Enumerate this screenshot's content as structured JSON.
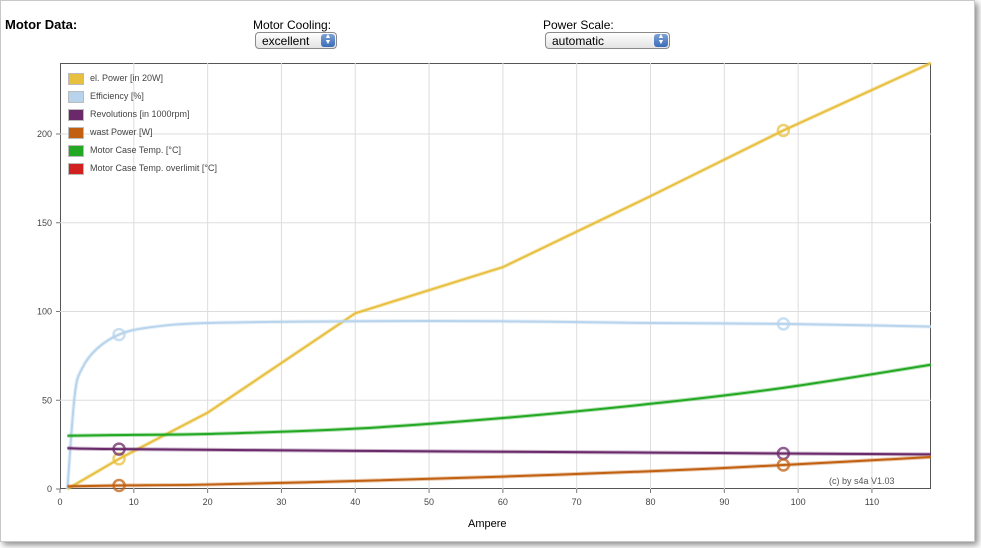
{
  "header": {
    "title": "Motor Data:",
    "cooling_label": "Motor Cooling:",
    "cooling_value": "excellent",
    "power_scale_label": "Power Scale:",
    "power_scale_value": "automatic"
  },
  "credit": "(c) by s4a   V1.03",
  "colors": {
    "power": "#e8c040",
    "efficiency": "#b8d4ec",
    "revolutions": "#6a2a6a",
    "waste": "#c06010",
    "case_temp": "#22a822",
    "overlimit": "#d02020"
  },
  "chart_data": {
    "type": "line",
    "xlabel": "Ampere",
    "ylabel": "",
    "xlim": [
      0,
      118
    ],
    "ylim": [
      0,
      240
    ],
    "xticks": [
      0,
      10,
      20,
      30,
      40,
      50,
      60,
      70,
      80,
      90,
      100,
      110
    ],
    "yticks": [
      0,
      50,
      100,
      150,
      200
    ],
    "grid": true,
    "legend_position": "top-left",
    "legend": [
      {
        "key": "power",
        "label": "el. Power [in 20W]"
      },
      {
        "key": "efficiency",
        "label": "Efficiency [%]"
      },
      {
        "key": "revolutions",
        "label": "Revolutions [in 1000rpm]"
      },
      {
        "key": "waste",
        "label": "wast Power [W]"
      },
      {
        "key": "case_temp",
        "label": "Motor Case Temp. [°C]"
      },
      {
        "key": "overlimit",
        "label": "Motor Case Temp. overlimit [°C]"
      }
    ],
    "series": [
      {
        "key": "power",
        "x": [
          1,
          8,
          20,
          40,
          60,
          80,
          98,
          118
        ],
        "y": [
          0,
          17,
          43,
          99,
          125,
          165,
          202,
          240
        ]
      },
      {
        "key": "efficiency",
        "x": [
          1,
          2,
          3,
          5,
          8,
          12,
          20,
          40,
          60,
          80,
          98,
          118
        ],
        "y": [
          0,
          53,
          68,
          79,
          87,
          91,
          93.5,
          94.5,
          94.5,
          93.5,
          93,
          91.5
        ]
      },
      {
        "key": "revolutions",
        "x": [
          1,
          8,
          40,
          60,
          80,
          98,
          118
        ],
        "y": [
          23,
          22.5,
          21.5,
          21,
          20.5,
          20,
          19.5
        ]
      },
      {
        "key": "waste",
        "x": [
          1,
          8,
          20,
          40,
          60,
          80,
          98,
          118
        ],
        "y": [
          1.5,
          2,
          2.5,
          4.5,
          7,
          10,
          13.5,
          18
        ]
      },
      {
        "key": "case_temp",
        "x": [
          1,
          10,
          20,
          40,
          60,
          80,
          98,
          118
        ],
        "y": [
          30,
          30.5,
          31,
          34,
          40,
          48,
          57,
          70
        ]
      }
    ],
    "markers": [
      {
        "key": "power",
        "x": 8,
        "y": 17
      },
      {
        "key": "power",
        "x": 98,
        "y": 202
      },
      {
        "key": "efficiency",
        "x": 8,
        "y": 87
      },
      {
        "key": "efficiency",
        "x": 98,
        "y": 93
      },
      {
        "key": "revolutions",
        "x": 8,
        "y": 22.5
      },
      {
        "key": "revolutions",
        "x": 98,
        "y": 20
      },
      {
        "key": "waste",
        "x": 8,
        "y": 2
      },
      {
        "key": "waste",
        "x": 98,
        "y": 13.5
      }
    ]
  }
}
